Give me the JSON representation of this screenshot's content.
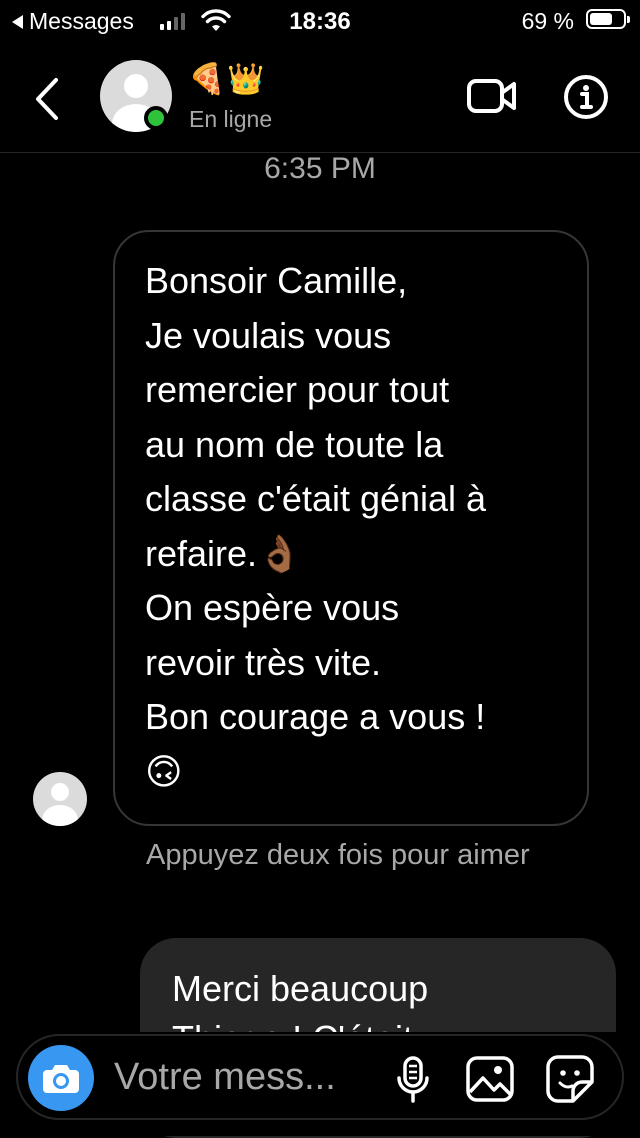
{
  "status_bar": {
    "back_app": "Messages",
    "time": "18:36",
    "battery": "69 %",
    "battery_level": 0.69,
    "signal_bars": 2
  },
  "header": {
    "back_icon": "chevron-left-icon",
    "contact_emojis": "🍕👑",
    "presence": "En ligne",
    "video_icon": "video-camera-icon",
    "info_icon": "info-icon"
  },
  "thread": {
    "timestamp": "6:35 PM",
    "incoming": {
      "lines": [
        "Bonsoir Camille,",
        "Je voulais vous",
        "remercier pour tout",
        "au nom de toute la",
        "classe c'était génial à",
        "refaire.👌🏾",
        "On espère vous",
        "revoir très vite.",
        "Bon courage a vous !",
        "🙃"
      ]
    },
    "hint": "Appuyez deux fois pour aimer",
    "outgoing": {
      "lines": [
        "Merci beaucoup",
        "Thiago ! C'était"
      ]
    }
  },
  "composer": {
    "placeholder": "Votre mess...",
    "camera_icon": "camera-icon",
    "mic_icon": "microphone-icon",
    "gallery_icon": "image-icon",
    "sticker_icon": "sticker-icon"
  },
  "colors": {
    "background": "#000000",
    "online": "#2ec33a",
    "camera_button": "#3897f0",
    "secondary_text": "#a8a8a8",
    "outgoing_bubble": "#262626"
  }
}
